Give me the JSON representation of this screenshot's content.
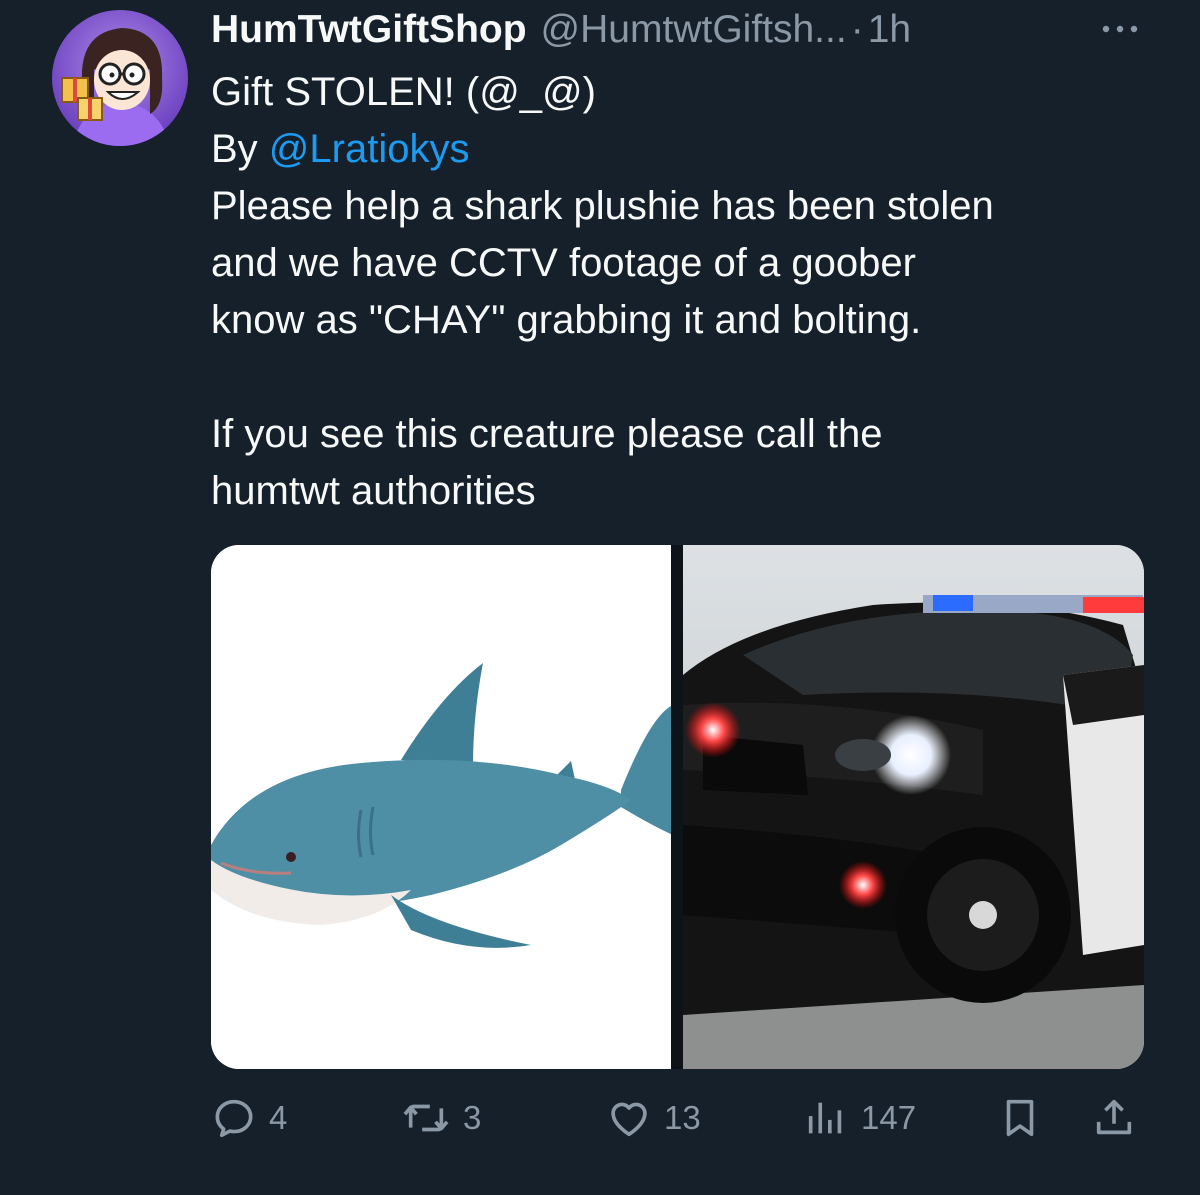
{
  "tweet": {
    "display_name": "HumTwtGiftShop",
    "handle": "@HumtwtGiftsh...",
    "separator": "·",
    "time": "1h",
    "lines": {
      "title": "Gift STOLEN!  (@_@)",
      "by_prefix": "By ",
      "mention": "@Lratiokys",
      "body_1": "Please help a shark plushie has been stolen",
      "body_2": "and we have CCTV footage of a goober",
      "body_3": "know as \"CHAY\" grabbing it and bolting.",
      "body_4": "If you see this creature please call the",
      "body_5": "humtwt authorities"
    },
    "media": [
      {
        "subject": "blue shark plushie on white background"
      },
      {
        "subject": "black police car with flashing lights"
      }
    ],
    "actions": {
      "replies": "4",
      "retweets": "3",
      "likes": "13",
      "views": "147"
    }
  },
  "icons": {
    "more": "more-horizontal-icon",
    "reply": "reply-icon",
    "retweet": "retweet-icon",
    "like": "heart-icon",
    "views": "views-icon",
    "bookmark": "bookmark-icon",
    "share": "share-icon"
  },
  "colors": {
    "background": "#15202b",
    "primary_text": "#f7f9f9",
    "secondary_text": "#8b98a5",
    "link": "#1d9bf0"
  }
}
